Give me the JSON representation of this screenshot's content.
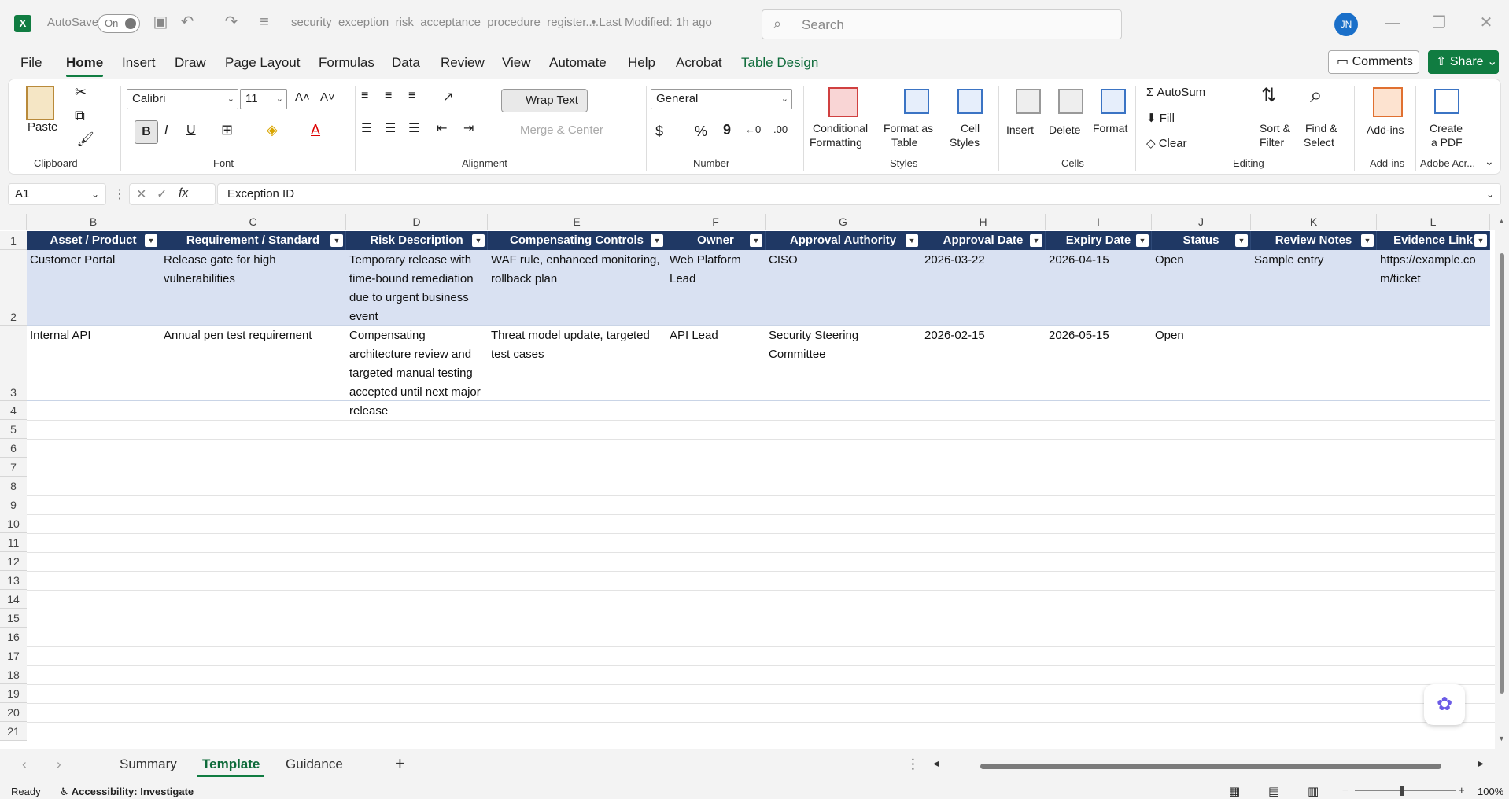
{
  "titlebar": {
    "autosave_label": "AutoSave",
    "autosave_state": "On",
    "filename": "security_exception_risk_acceptance_procedure_register....",
    "modified": "• Last Modified: 1h ago",
    "search_placeholder": "Search",
    "user_initials": "JN"
  },
  "menu": {
    "tabs": [
      "File",
      "Home",
      "Insert",
      "Draw",
      "Page Layout",
      "Formulas",
      "Data",
      "Review",
      "View",
      "Automate",
      "Help",
      "Acrobat",
      "Table Design"
    ],
    "comments_label": "Comments",
    "share_label": "Share"
  },
  "ribbon": {
    "clipboard": {
      "paste": "Paste",
      "label": "Clipboard"
    },
    "font": {
      "name": "Calibri",
      "size": "11",
      "label": "Font",
      "bold": "B",
      "italic": "I",
      "underline": "U"
    },
    "alignment": {
      "wrap_text": "Wrap Text",
      "merge_center": "Merge & Center",
      "label": "Alignment"
    },
    "number": {
      "format": "General",
      "label": "Number",
      "currency": "$",
      "percent": "%",
      "comma": "9"
    },
    "styles": {
      "conditional": "Conditional",
      "formatting": "Formatting",
      "format_as": "Format as",
      "table": "Table",
      "cell": "Cell",
      "cell_styles": "Styles",
      "label": "Styles"
    },
    "cells": {
      "insert": "Insert",
      "delete": "Delete",
      "format": "Format",
      "label": "Cells"
    },
    "editing": {
      "autosum": "AutoSum",
      "fill": "Fill",
      "clear": "Clear",
      "sort": "Sort &",
      "filter": "Filter",
      "find": "Find &",
      "select": "Select",
      "label": "Editing"
    },
    "addins": {
      "addins": "Add-ins",
      "label": "Add-ins"
    },
    "adobe": {
      "create": "Create",
      "pdf": "a PDF",
      "label": "Adobe Acr..."
    }
  },
  "formula_bar": {
    "cell_ref": "A1",
    "fx": "fx",
    "content": "Exception ID"
  },
  "grid": {
    "columns": [
      "B",
      "C",
      "D",
      "E",
      "F",
      "G",
      "H",
      "I",
      "J",
      "K",
      "L"
    ],
    "headers": [
      "Asset / Product",
      "Requirement / Standard",
      "Risk Description",
      "Compensating Controls",
      "Owner",
      "Approval Authority",
      "Approval Date",
      "Expiry Date",
      "Status",
      "Review Notes",
      "Evidence Link"
    ],
    "rows": [
      [
        "Customer Portal",
        "Release gate for high vulnerabilities",
        "Temporary release with time-bound remediation due to urgent business event",
        "WAF rule, enhanced monitoring, rollback plan",
        "Web Platform Lead",
        "CISO",
        "2026-03-22",
        "2026-04-15",
        "Open",
        "Sample entry",
        "https://example.com/ticket"
      ],
      [
        "Internal API",
        "Annual pen test requirement",
        "Compensating architecture review and targeted manual testing accepted until next major release",
        "Threat model update, targeted test cases",
        "API Lead",
        "Security Steering Committee",
        "2026-02-15",
        "2026-05-15",
        "Open",
        "",
        ""
      ]
    ],
    "row_numbers": [
      "1",
      "2",
      "3",
      "4",
      "5",
      "6",
      "7",
      "8",
      "9",
      "10",
      "11",
      "12",
      "13",
      "14",
      "15",
      "16",
      "17",
      "18",
      "19",
      "20",
      "21"
    ]
  },
  "sheets": {
    "tabs": [
      "Summary",
      "Template",
      "Guidance"
    ],
    "active": "Template",
    "add": "+"
  },
  "statusbar": {
    "ready": "Ready",
    "accessibility": "Accessibility: Investigate",
    "zoom": "100%"
  }
}
